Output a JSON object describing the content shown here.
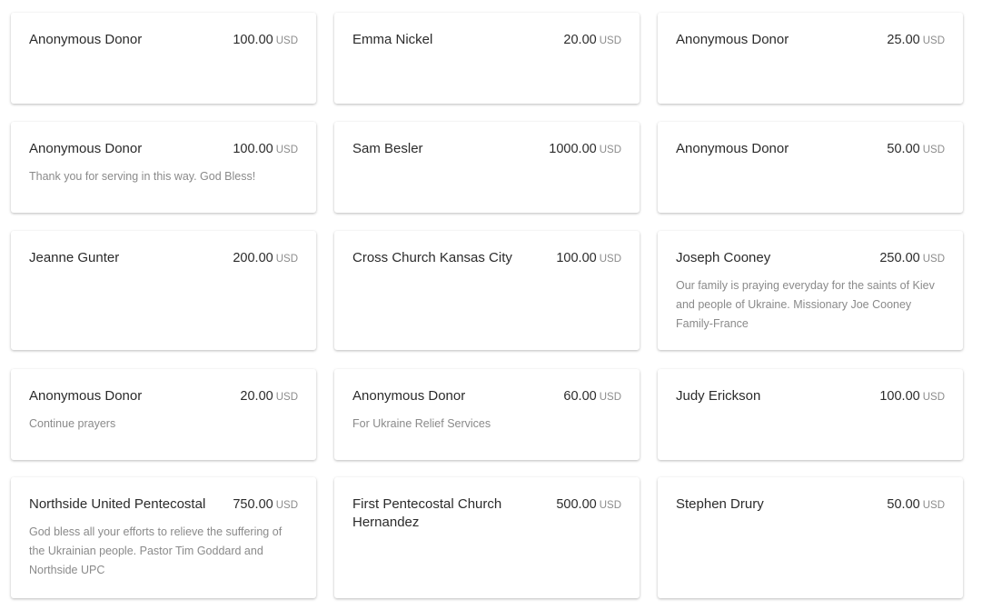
{
  "donations": [
    {
      "name": "Anonymous Donor",
      "amount": "100.00",
      "currency": "USD",
      "message": ""
    },
    {
      "name": "Emma Nickel",
      "amount": "20.00",
      "currency": "USD",
      "message": ""
    },
    {
      "name": "Anonymous Donor",
      "amount": "25.00",
      "currency": "USD",
      "message": ""
    },
    {
      "name": "Anonymous Donor",
      "amount": "100.00",
      "currency": "USD",
      "message": "Thank you for serving in this way. God Bless!"
    },
    {
      "name": "Sam Besler",
      "amount": "1000.00",
      "currency": "USD",
      "message": ""
    },
    {
      "name": "Anonymous Donor",
      "amount": "50.00",
      "currency": "USD",
      "message": ""
    },
    {
      "name": "Jeanne Gunter",
      "amount": "200.00",
      "currency": "USD",
      "message": ""
    },
    {
      "name": "Cross Church Kansas City",
      "amount": "100.00",
      "currency": "USD",
      "message": ""
    },
    {
      "name": "Joseph Cooney",
      "amount": "250.00",
      "currency": "USD",
      "message": "Our family is praying everyday for the saints of Kiev and people of Ukraine. Missionary Joe Cooney Family-France"
    },
    {
      "name": "Anonymous Donor",
      "amount": "20.00",
      "currency": "USD",
      "message": "Continue prayers"
    },
    {
      "name": "Anonymous Donor",
      "amount": "60.00",
      "currency": "USD",
      "message": "For Ukraine Relief Services"
    },
    {
      "name": "Judy Erickson",
      "amount": "100.00",
      "currency": "USD",
      "message": ""
    },
    {
      "name": "Northside United Pentecostal",
      "amount": "750.00",
      "currency": "USD",
      "message": "God bless all your efforts to relieve the suffering of the Ukrainian people. Pastor Tim Goddard and Northside UPC"
    },
    {
      "name": "First Pentecostal Church Hernandez",
      "amount": "500.00",
      "currency": "USD",
      "message": ""
    },
    {
      "name": "Stephen Drury",
      "amount": "50.00",
      "currency": "USD",
      "message": ""
    }
  ]
}
